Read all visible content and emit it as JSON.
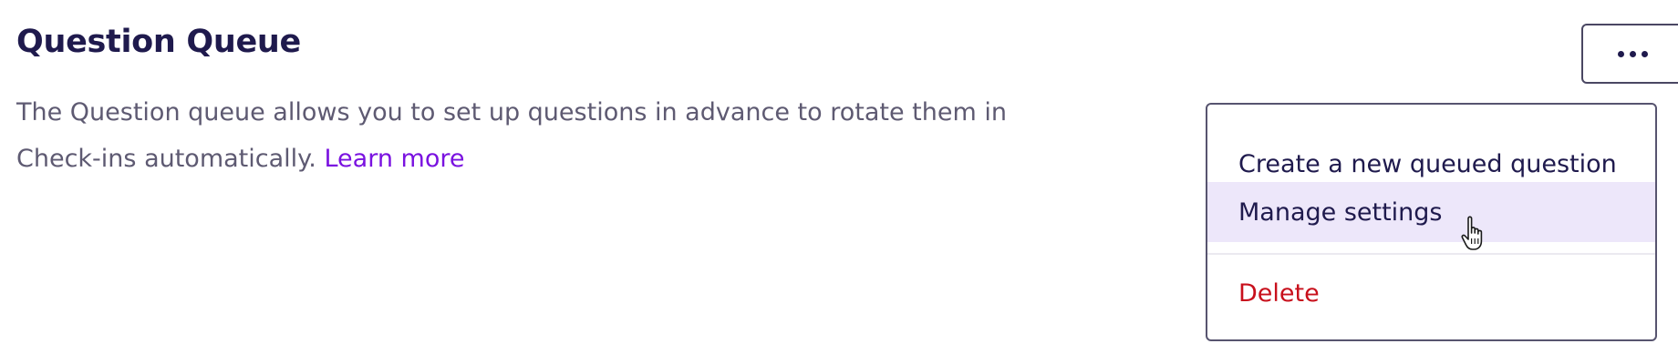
{
  "section": {
    "title": "Question Queue",
    "description": "The Question queue allows you to set up questions in advance to rotate them in Check-ins automatically.",
    "learn_more_label": "Learn more"
  },
  "more_button": {
    "icon": "more-horizontal-icon"
  },
  "menu": {
    "items": [
      {
        "label": "Create a new queued question",
        "state": "default"
      },
      {
        "label": "Manage settings",
        "state": "hovered"
      },
      {
        "label": "Delete",
        "state": "destructive"
      }
    ]
  },
  "colors": {
    "title": "#1f1a4d",
    "body_text": "#5e5a72",
    "link": "#7a12e0",
    "hover_background": "#ede7fa",
    "danger": "#c8101c",
    "border": "#57546f"
  },
  "cursor": {
    "icon": "hand-pointer-icon"
  }
}
